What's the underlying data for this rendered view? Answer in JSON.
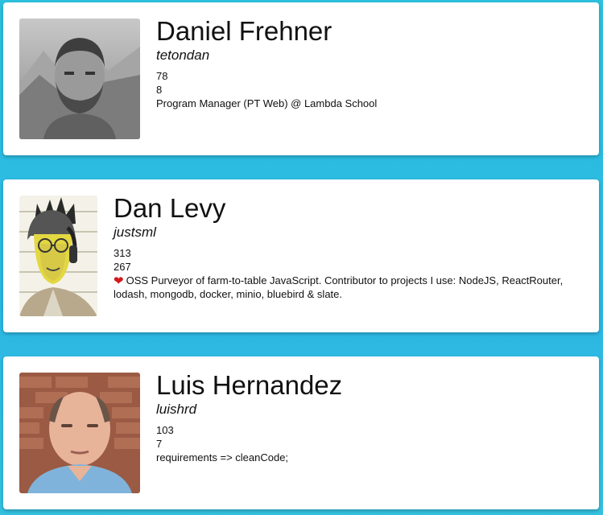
{
  "cards": [
    {
      "name": "Daniel Frehner",
      "username": "tetondan",
      "followers": "78",
      "following": "8",
      "bio": "Program Manager (PT Web) @ Lambda School"
    },
    {
      "name": "Dan Levy",
      "username": "justsml",
      "followers": "313",
      "following": "267",
      "bio_emoji": "heart-emoji",
      "bio": "OSS Purveyor of farm-to-table JavaScript. Contributor to projects I use: NodeJS, ReactRouter, lodash, mongodb, docker, minio, bluebird & slate."
    },
    {
      "name": "Luis Hernandez",
      "username": "luishrd",
      "followers": "103",
      "following": "7",
      "bio": "requirements => cleanCode;"
    }
  ],
  "colors": {
    "background": "#2cbde0",
    "card": "#ffffff",
    "heart": "#d11a1a"
  }
}
